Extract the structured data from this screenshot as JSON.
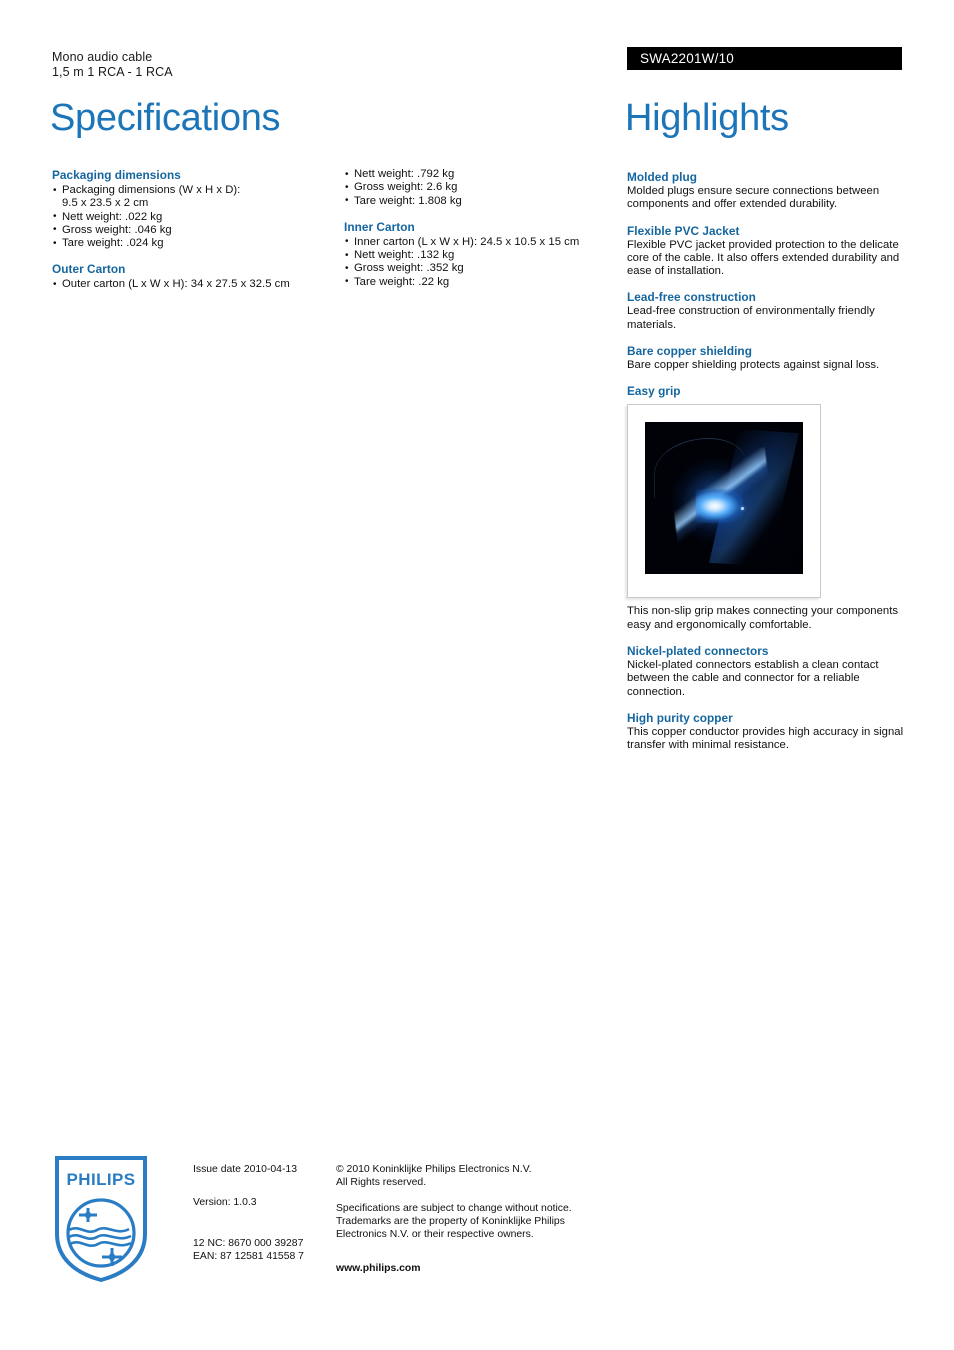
{
  "header": {
    "product_name": "Mono audio cable",
    "product_subtitle": "1,5 m 1 RCA - 1 RCA",
    "model_number": "SWA2201W/10",
    "title_left": "Specifications",
    "title_right": "Highlights"
  },
  "colors": {
    "heading_blue": "#15659f",
    "title_blue": "#1b75b8",
    "model_bar_bg": "#000000",
    "text": "#111111"
  },
  "specifications": {
    "column1": [
      {
        "heading": "Packaging dimensions",
        "items": [
          {
            "text": "Packaging dimensions (W x H x D):",
            "cont": "9.5 x 23.5 x 2 cm"
          },
          {
            "text": "Nett weight: .022 kg"
          },
          {
            "text": "Gross weight: .046 kg"
          },
          {
            "text": "Tare weight: .024 kg"
          }
        ]
      },
      {
        "heading": "Outer Carton",
        "items": [
          {
            "text": "Outer carton (L x W x H): 34 x 27.5 x 32.5 cm"
          }
        ]
      }
    ],
    "column2": [
      {
        "heading": "",
        "items": [
          {
            "text": "Nett weight: .792 kg"
          },
          {
            "text": "Gross weight: 2.6 kg"
          },
          {
            "text": "Tare weight: 1.808 kg"
          }
        ]
      },
      {
        "heading": "Inner Carton",
        "items": [
          {
            "text": "Inner carton (L x W x H): 24.5 x 10.5 x 15 cm"
          },
          {
            "text": "Nett weight: .132 kg"
          },
          {
            "text": "Gross weight: .352 kg"
          },
          {
            "text": "Tare weight: .22 kg"
          }
        ]
      }
    ]
  },
  "highlights": [
    {
      "title": "Molded plug",
      "body": "Molded plugs ensure secure connections between components and offer extended durability."
    },
    {
      "title": "Flexible PVC Jacket",
      "body": "Flexible PVC jacket provided protection to the delicate core of the cable. It also offers extended durability and ease of installation."
    },
    {
      "title": "Lead-free construction",
      "body": "Lead-free construction of environmentally friendly materials."
    },
    {
      "title": "Bare copper shielding",
      "body": "Bare copper shielding protects against signal loss."
    },
    {
      "title": "Easy grip",
      "body": "This non-slip grip makes connecting your components easy and ergonomically comfortable.",
      "has_image": true
    },
    {
      "title": "Nickel-plated connectors",
      "body": "Nickel-plated connectors establish a clean contact between the cable and connector for a reliable connection."
    },
    {
      "title": "High purity copper",
      "body": "This copper conductor provides high accuracy in signal transfer with minimal resistance."
    }
  ],
  "footer": {
    "logo_wordmark": "PHILIPS",
    "issue_date": "Issue date 2010-04-13",
    "version": "Version: 1.0.3",
    "nc_code": "12 NC: 8670 000 39287",
    "ean_code": "EAN: 87 12581 41558 7",
    "copyright_line1": "© 2010 Koninklijke Philips Electronics N.V.",
    "copyright_line2": "All Rights reserved.",
    "disclaimer": "Specifications are subject to change without notice. Trademarks are the property of Koninklijke Philips Electronics N.V. or their respective owners.",
    "website": "www.philips.com"
  }
}
